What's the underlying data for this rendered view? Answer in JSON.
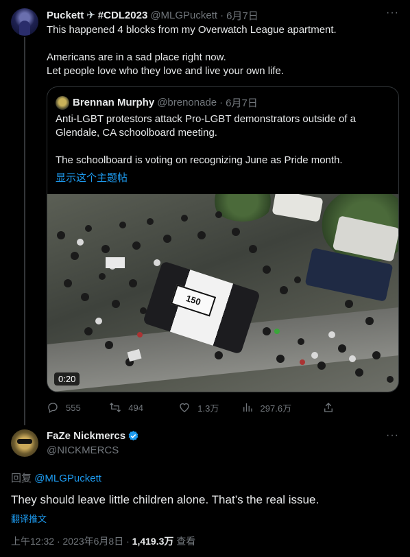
{
  "tweet": {
    "author_name": "Puckett",
    "author_name_suffix": "#CDL2023",
    "handle": "@MLGPuckett",
    "separator": "·",
    "date": "6月7日",
    "text_lines": [
      "This happened 4 blocks from my Overwatch League apartment.",
      "",
      "Americans are in a sad place right now.",
      "Let people love who they love and live your own life."
    ],
    "quote": {
      "author_name": "Brennan Murphy",
      "handle": "@brenonade",
      "separator": "·",
      "date": "6月7日",
      "text_lines": [
        "Anti-LGBT protestors attack Pro-LGBT demonstrators outside of a",
        "Glendale, CA schoolboard meeting.",
        "",
        "The schoolboard is voting on recognizing June as Pride month."
      ],
      "show_thread_link": "显示这个主题帖",
      "video_time": "0:20",
      "police_car_number": "150"
    },
    "actions": {
      "replies": "555",
      "retweets": "494",
      "likes": "1.3万",
      "views": "297.6万"
    }
  },
  "reply": {
    "author_name": "FaZe Nickmercs",
    "handle": "@NICKMERCS",
    "reply_to_label": "回复",
    "reply_to_handle": "@MLGPuckett",
    "text": "They should leave little children alone. That’s the real issue.",
    "translate_label": "翻译推文",
    "time": "上午12:32",
    "separator": "·",
    "date": "2023年6月8日",
    "views_count": "1,419.3万",
    "views_label": "查看"
  },
  "colors": {
    "accent": "#1d9bf0",
    "muted": "#71767b",
    "text": "#e7e9ea",
    "background": "#000000",
    "border": "#2f3336"
  },
  "icons": {
    "more": "more-horizontal-icon",
    "reply": "reply-icon",
    "retweet": "retweet-icon",
    "like": "heart-icon",
    "views": "bar-chart-icon",
    "share": "share-icon",
    "verified": "verified-badge-icon",
    "airplane": "airplane-emoji-icon"
  }
}
